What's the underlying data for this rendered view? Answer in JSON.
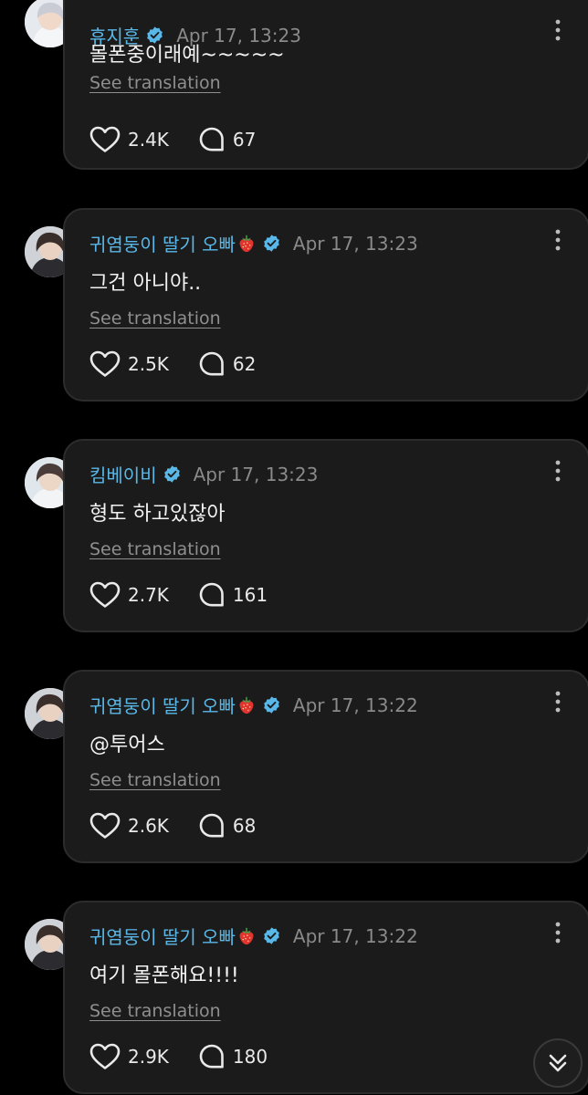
{
  "ui": {
    "translate_label": "See translation",
    "icons": {
      "like": "heart-icon",
      "comment": "speech-bubble-icon",
      "more": "more-vertical-icon",
      "verified": "verified-badge-icon",
      "scroll": "double-chevron-down-icon"
    },
    "colors": {
      "background": "#000000",
      "card": "#1b1b1b",
      "author": "#5ab8e8",
      "verified": "#5ab8e8",
      "muted": "#8a8a8a"
    }
  },
  "posts": [
    {
      "author": "휴지훈",
      "author_emoji": "",
      "time": "Apr 17, 13:23",
      "body": "몰폰중이래예~~~~~",
      "likes": "2.4K",
      "comments": "67"
    },
    {
      "author": "귀염둥이 딸기 오빠",
      "author_emoji": "strawberry",
      "time": "Apr 17, 13:23",
      "body": "그건 아니야..",
      "likes": "2.5K",
      "comments": "62"
    },
    {
      "author": "킴베이비",
      "author_emoji": "",
      "time": "Apr 17, 13:23",
      "body": "형도 하고있잖아",
      "likes": "2.7K",
      "comments": "161"
    },
    {
      "author": "귀염둥이 딸기 오빠",
      "author_emoji": "strawberry",
      "time": "Apr 17, 13:22",
      "body": "@투어스",
      "likes": "2.6K",
      "comments": "68"
    },
    {
      "author": "귀염둥이 딸기 오빠",
      "author_emoji": "strawberry",
      "time": "Apr 17, 13:22",
      "body": "여기 몰폰해요!!!!",
      "likes": "2.9K",
      "comments": "180"
    }
  ]
}
